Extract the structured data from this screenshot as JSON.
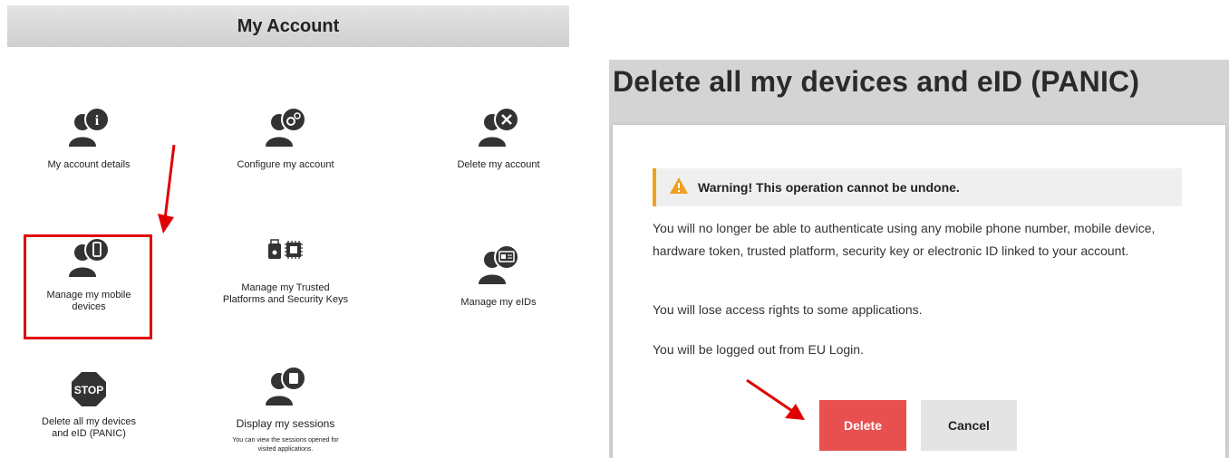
{
  "account": {
    "title": "My Account",
    "tiles": [
      {
        "label": "My account details",
        "icon": "user-info-icon"
      },
      {
        "label": "Configure my account",
        "icon": "user-gear-icon"
      },
      {
        "label": "Delete my account",
        "icon": "user-delete-icon"
      },
      {
        "label": "Manage my mobile devices",
        "icon": "user-mobile-icon"
      },
      {
        "label": "Manage my Trusted Platforms and Security Keys",
        "icon": "security-key-chip-icon"
      },
      {
        "label": "Manage my eIDs",
        "icon": "user-eid-icon"
      },
      {
        "label": "Delete all my devices and eID (PANIC)",
        "icon": "stop-sign-icon",
        "icon_text": "STOP"
      },
      {
        "label": "Display my sessions",
        "sub": "You can view the sessions opened for visited applications.",
        "icon": "user-session-icon"
      }
    ]
  },
  "panic": {
    "title": "Delete all my devices and eID (PANIC)",
    "warning": "Warning! This operation cannot be undone.",
    "paragraphs": [
      "You will no longer be able to authenticate using any mobile phone number, mobile device, hardware token, trusted platform, security key or electronic ID linked to your account.",
      "You will lose access rights to some applications.",
      "You will be logged out from EU Login."
    ],
    "delete_label": "Delete",
    "cancel_label": "Cancel"
  },
  "colors": {
    "accent_red": "#e00000",
    "delete_button": "#e85050",
    "warning_orange": "#f0a020",
    "icon_dark": "#333333"
  }
}
